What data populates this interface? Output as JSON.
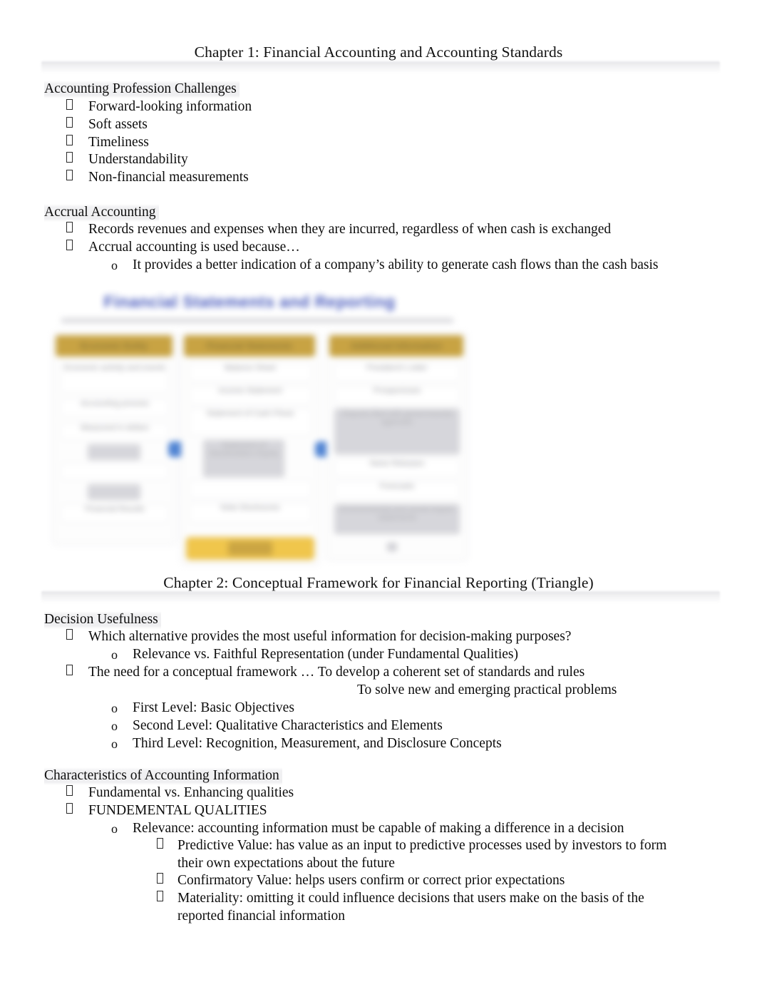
{
  "document": {
    "header_title": "Chapter 1: Financial Accounting and Accounting Standards",
    "header_title_2": "Chapter 2: Conceptual Framework for Financial Reporting (Triangle)"
  },
  "colors": {
    "diagram_title_blue": "#4356bb",
    "diagram_caption_gold": "#c6a03c",
    "diagram_bottom_yellow": "#f0c445",
    "diagram_connector_blue": "#4a80d2",
    "heading_highlight_gray": "#e6e6e9",
    "body_text": "#0d0d0d"
  },
  "sections": {
    "accounting_profession_challenges": {
      "heading": "Accounting Profession Challenges",
      "bullets": [
        "Forward-looking information",
        "Soft assets",
        "Timeliness",
        "Understandability",
        "Non-financial measurements"
      ]
    },
    "accrual_accounting": {
      "heading": "Accrual Accounting",
      "bullets": [
        "Records revenues and expenses when they are incurred, regardless of when cash is exchanged",
        "Accrual accounting is used because…"
      ],
      "sub_bullets": [
        "It provides a better indication of a company’s ability to generate cash flows than the cash basis"
      ]
    },
    "decision_usefulness": {
      "heading": "Decision Usefulness",
      "bullet_1": "Which alternative provides the most useful information for decision-making purposes?",
      "sub_bullet_1": "Relevance vs. Faithful Representation (under Fundamental Qualities)",
      "bullet_2": "The need for a conceptual framework  … To develop a coherent set of standards and rules",
      "bullet_2_continuation": "To solve new and emerging practical problems",
      "levels": [
        "First Level: Basic Objectives",
        "Second Level: Qualitative Characteristics and Elements",
        "Third Level: Recognition, Measurement, and Disclosure Concepts"
      ]
    },
    "characteristics_of_accounting_information": {
      "heading": "Characteristics of Accounting Information",
      "bullets": [
        "Fundamental vs. Enhancing qualities",
        "FUNDEMENTAL QUALITIES"
      ],
      "sub_bullet": "Relevance: accounting information must be capable of making a difference in a decision",
      "third_level": [
        "Predictive Value:  has value as an input to predictive processes used by investors to form their own expectations about the future",
        "Confirmatory Value:  helps users confirm or correct prior expectations",
        "Materiality:  omitting it could influence decisions that users make on the basis of the reported financial information"
      ]
    }
  },
  "diagram": {
    "title": "Financial Statements and Reporting",
    "columns": [
      {
        "caption": "Economic Entity",
        "boxes": [
          "Economic activity and events",
          "Accounting process",
          "Measured in dollars",
          "Financial Results"
        ]
      },
      {
        "caption": "Financial Statements",
        "boxes": [
          "Balance Sheet",
          "Income Statement",
          "Statement of Cash Flows",
          "Statement of Stockholders Equity",
          "Note Disclosures"
        ],
        "bottom_label": "GAAP"
      },
      {
        "caption": "Additional Information",
        "boxes": [
          "President's Letter",
          "Prospectuses",
          "Reports filed with governmental agencies",
          "News Releases",
          "Forecasts",
          "Environmental and social impact statements"
        ]
      }
    ]
  }
}
